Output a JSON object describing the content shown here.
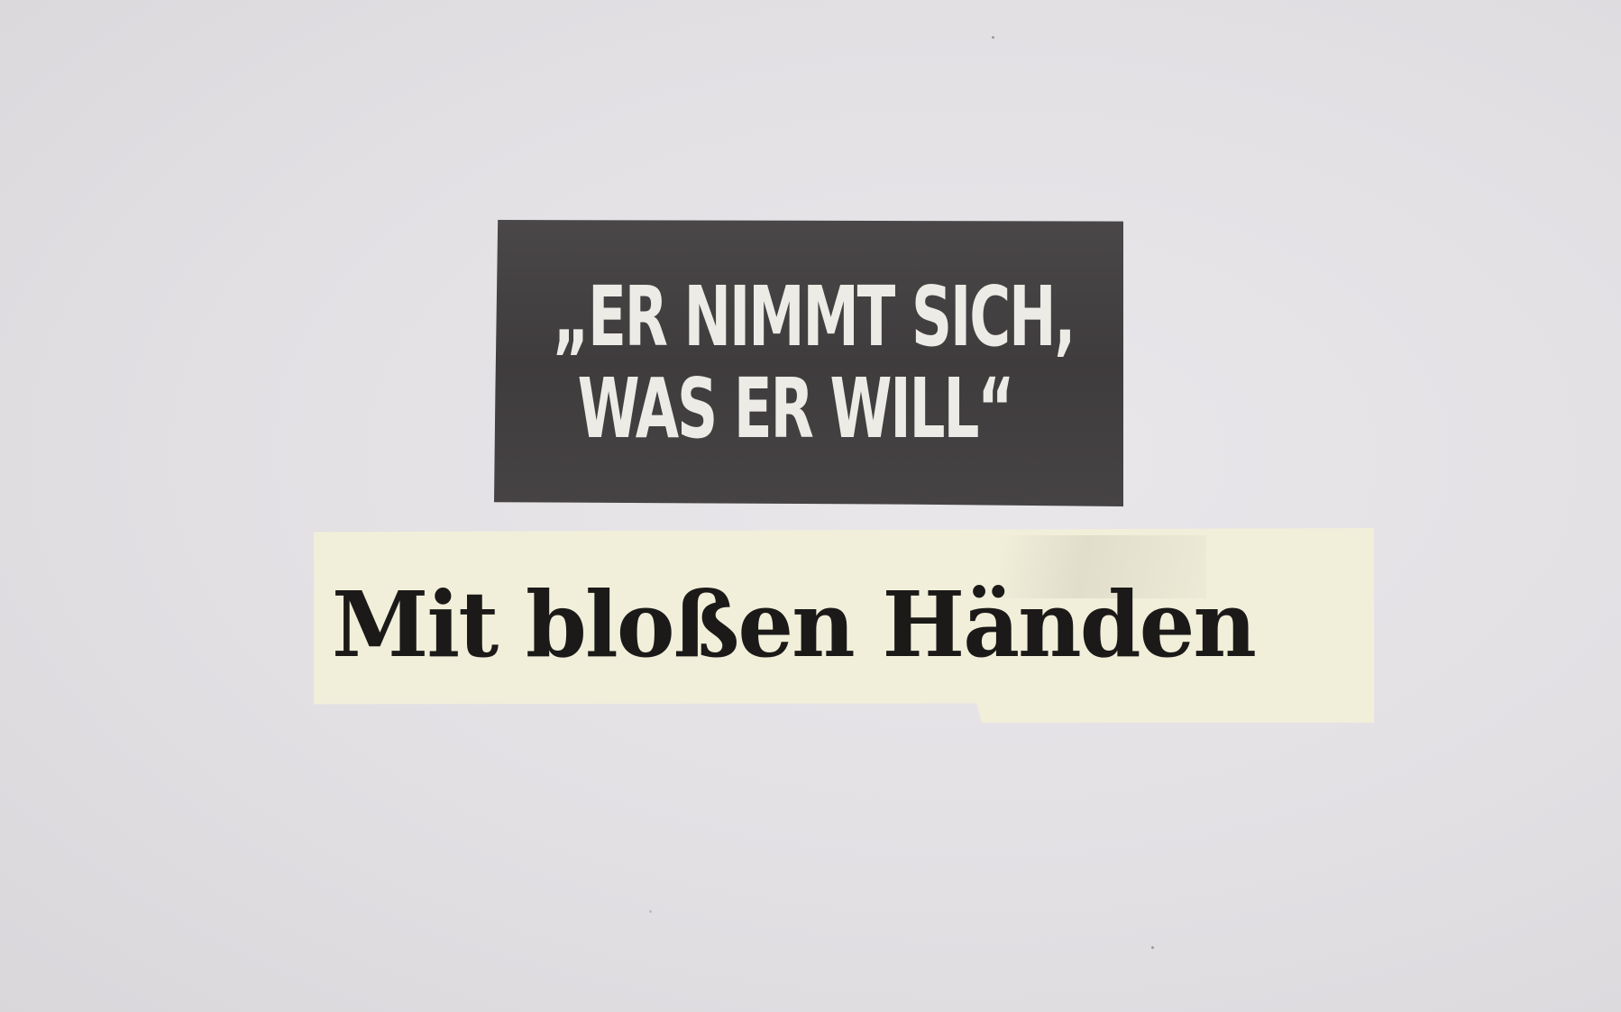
{
  "clipping_quote": {
    "line1": "„ER NIMMT SICH,",
    "line2": "WAS ER WILL“"
  },
  "clipping_headline": {
    "text": "Mit bloßen Händen"
  },
  "colors": {
    "background_paper": "#e2e0e3",
    "quote_clip_bg": "#434041",
    "quote_text": "#ecebe6",
    "headline_clip_bg": "#f1efd9",
    "headline_text": "#1b1a19"
  }
}
